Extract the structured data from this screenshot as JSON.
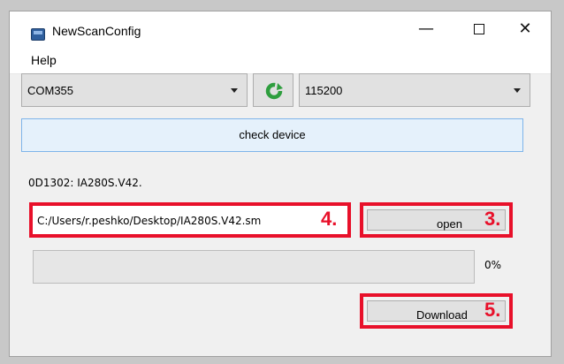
{
  "window": {
    "title": "NewScanConfig",
    "icon": "app-window-icon",
    "controls": {
      "minimize": "—",
      "maximize": "maximize-icon",
      "close": "✕"
    }
  },
  "menu": {
    "items": [
      "Help"
    ]
  },
  "port_select": {
    "value": "COM355",
    "icon": "chevron-down-icon"
  },
  "refresh_button": {
    "icon": "refresh-icon",
    "color": "#2e9e3e"
  },
  "baud_select": {
    "value": "115200",
    "icon": "chevron-down-icon"
  },
  "check_button": {
    "label": "check device"
  },
  "device_info": "0D1302: IA280S.V42.",
  "file_path": {
    "value": "C:/Users/r.peshko/Desktop/IA280S.V42.sm"
  },
  "open_button": {
    "label": "open"
  },
  "progress": {
    "value": 0,
    "text": "0%"
  },
  "download_button": {
    "label": "Download"
  },
  "annotations": {
    "step_path": "4.",
    "step_open": "3.",
    "step_download": "5.",
    "color": "#e8102a"
  }
}
